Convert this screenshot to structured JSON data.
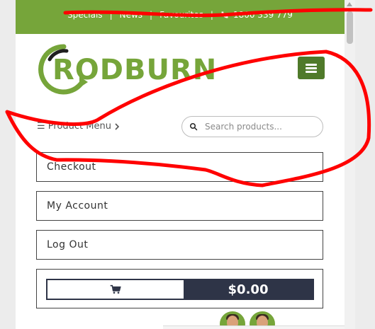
{
  "topbar": {
    "links": [
      "Specials",
      "News",
      "Favourites"
    ],
    "separator": "|",
    "phone": "1800 339 779",
    "color": "#76a53a"
  },
  "logo": {
    "text": "RODBURN"
  },
  "nav": {
    "product_menu_label": "☰ Product Menu",
    "menu_icon": "hamburger-icon"
  },
  "search": {
    "placeholder": "Search products..."
  },
  "account_links": [
    {
      "label": "Checkout"
    },
    {
      "label": "My Account"
    },
    {
      "label": "Log Out"
    }
  ],
  "cart": {
    "total": "$0.00",
    "icon": "cart-icon",
    "color": "#2e3447"
  }
}
